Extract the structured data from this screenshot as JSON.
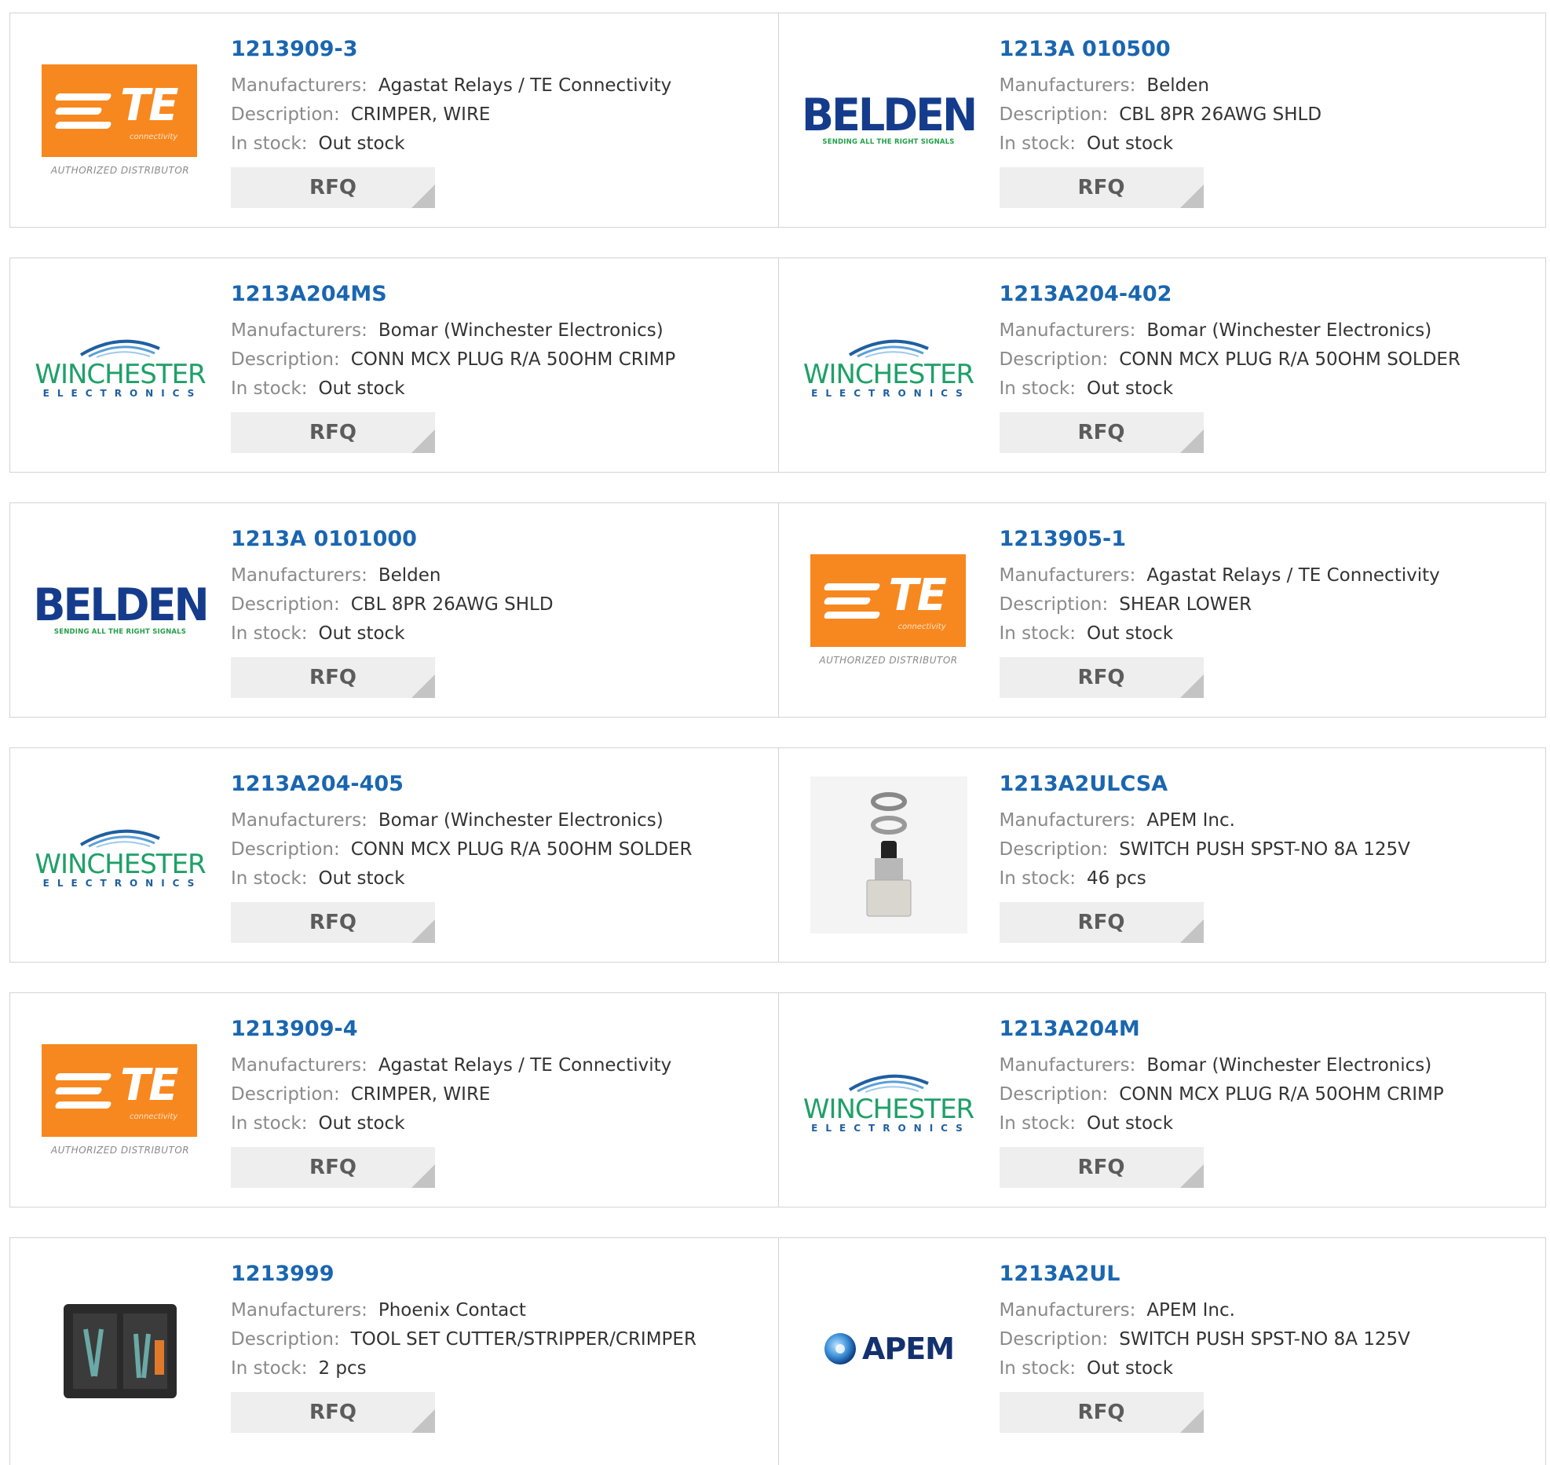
{
  "labels": {
    "manufacturers": "Manufacturers:",
    "description": "Description:",
    "in_stock": "In stock:",
    "rfq": "RFQ"
  },
  "logo_text": {
    "te": "TE",
    "te_sub": "connectivity",
    "te_authorized": "AUTHORIZED DISTRIBUTOR",
    "belden": "BELDEN",
    "belden_sub": "SENDING ALL THE RIGHT SIGNALS",
    "winchester": "WINCHESTER",
    "winchester_sub": "ELECTRONICS",
    "apem": "APEM"
  },
  "colors": {
    "link": "#1a66b0",
    "te_orange": "#f7881f",
    "belden_blue": "#153c8c",
    "winchester_green": "#1fa068",
    "apem_navy": "#14316f"
  },
  "products": [
    {
      "part_number": "1213909-3",
      "manufacturer": "Agastat Relays / TE Connectivity",
      "description": "CRIMPER, WIRE",
      "stock": "Out stock",
      "logo": "te-logo"
    },
    {
      "part_number": "1213A 010500",
      "manufacturer": "Belden",
      "description": "CBL 8PR 26AWG SHLD",
      "stock": "Out stock",
      "logo": "belden-logo"
    },
    {
      "part_number": "1213A204MS",
      "manufacturer": "Bomar (Winchester Electronics)",
      "description": "CONN MCX PLUG R/A 50OHM CRIMP",
      "stock": "Out stock",
      "logo": "winchester-logo"
    },
    {
      "part_number": "1213A204-402",
      "manufacturer": "Bomar (Winchester Electronics)",
      "description": "CONN MCX PLUG R/A 50OHM SOLDER",
      "stock": "Out stock",
      "logo": "winchester-logo"
    },
    {
      "part_number": "1213A 0101000",
      "manufacturer": "Belden",
      "description": "CBL 8PR 26AWG SHLD",
      "stock": "Out stock",
      "logo": "belden-logo"
    },
    {
      "part_number": "1213905-1",
      "manufacturer": "Agastat Relays / TE Connectivity",
      "description": "SHEAR LOWER",
      "stock": "Out stock",
      "logo": "te-logo"
    },
    {
      "part_number": "1213A204-405",
      "manufacturer": "Bomar (Winchester Electronics)",
      "description": "CONN MCX PLUG R/A 50OHM SOLDER",
      "stock": "Out stock",
      "logo": "winchester-logo"
    },
    {
      "part_number": "1213A2ULCSA",
      "manufacturer": "APEM Inc.",
      "description": "SWITCH PUSH SPST-NO 8A 125V",
      "stock": "46 pcs",
      "logo": "switch-photo"
    },
    {
      "part_number": "1213909-4",
      "manufacturer": "Agastat Relays / TE Connectivity",
      "description": "CRIMPER, WIRE",
      "stock": "Out stock",
      "logo": "te-logo"
    },
    {
      "part_number": "1213A204M",
      "manufacturer": "Bomar (Winchester Electronics)",
      "description": "CONN MCX PLUG R/A 50OHM CRIMP",
      "stock": "Out stock",
      "logo": "winchester-logo"
    },
    {
      "part_number": "1213999",
      "manufacturer": "Phoenix Contact",
      "description": "TOOL SET CUTTER/STRIPPER/CRIMPER",
      "stock": "2 pcs",
      "logo": "toolkit-photo"
    },
    {
      "part_number": "1213A2UL",
      "manufacturer": "APEM Inc.",
      "description": "SWITCH PUSH SPST-NO 8A 125V",
      "stock": "Out stock",
      "logo": "apem-logo"
    }
  ]
}
